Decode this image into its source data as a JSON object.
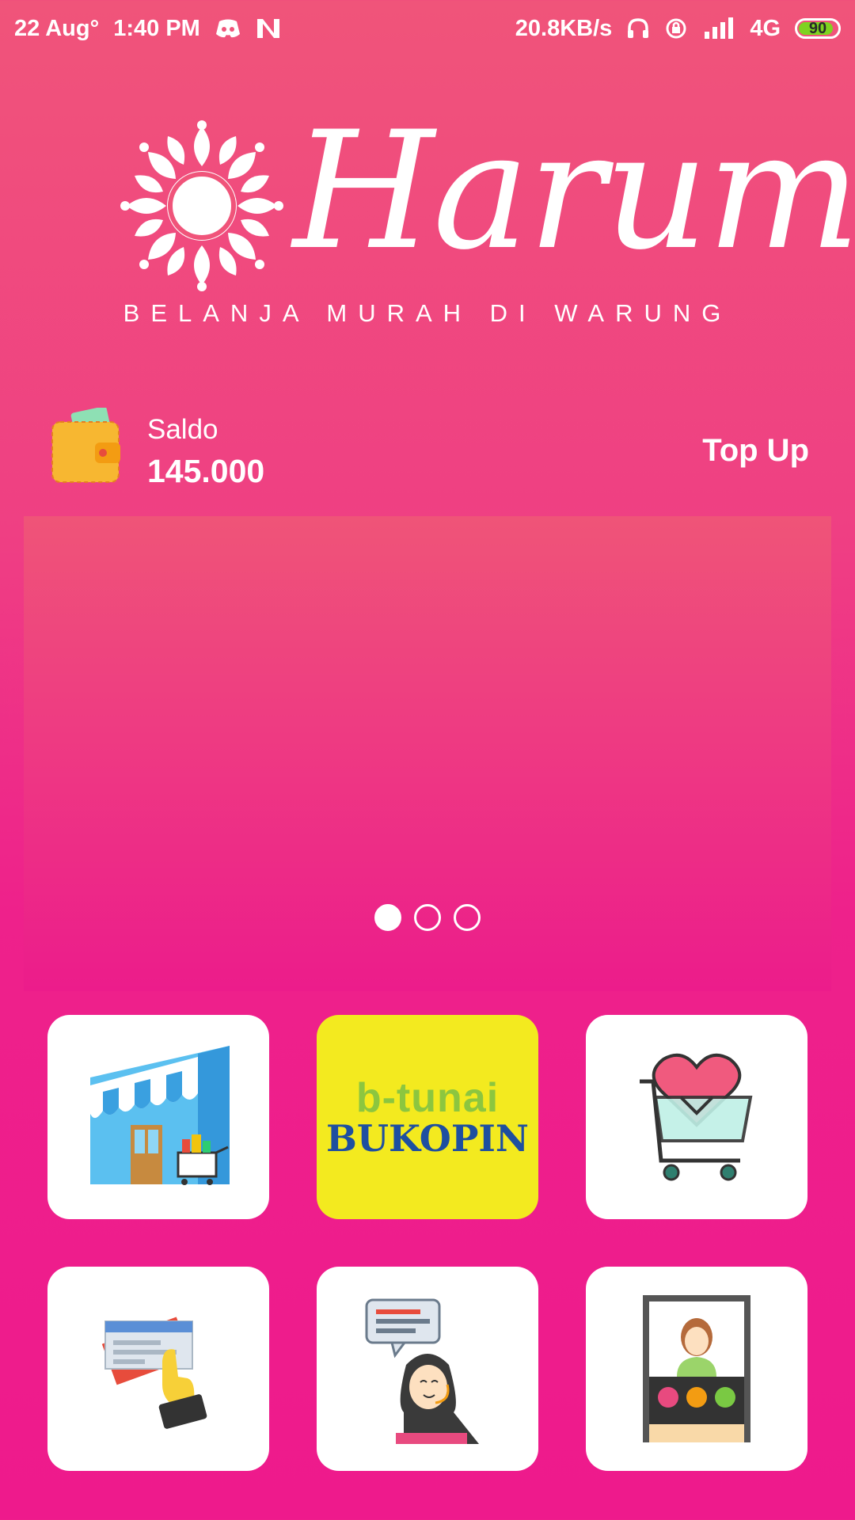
{
  "status_bar": {
    "date": "22 Aug°",
    "time": "1:40 PM",
    "network_speed": "20.8KB/s",
    "network_type": "4G",
    "battery": "90",
    "icons": [
      "discord-icon",
      "n-notification-icon",
      "headphones-icon",
      "rotation-lock-icon",
      "signal-icon",
      "battery-icon"
    ]
  },
  "brand": {
    "name": "Harum",
    "tagline": "BELANJA MURAH DI WARUNG"
  },
  "wallet": {
    "label": "Saldo",
    "value": "145.000",
    "topup_label": "Top Up"
  },
  "banner": {
    "slides": 3,
    "active_slide": 1
  },
  "tiles": [
    {
      "name": "store",
      "icon": "storefront-icon"
    },
    {
      "name": "b-tunai",
      "icon": "btunai-bukopin-logo",
      "logo_line1": "b-tunai",
      "logo_line2": "BUKOPIN"
    },
    {
      "name": "wishlist",
      "icon": "heart-cart-icon"
    },
    {
      "name": "tickets",
      "icon": "air-ticket-icon"
    },
    {
      "name": "customer-service",
      "icon": "customer-service-icon"
    },
    {
      "name": "video",
      "icon": "video-call-icon"
    }
  ],
  "colors": {
    "background_top": "#f0547a",
    "background_bottom": "#ee1a8c",
    "tile_bg": "#ffffff",
    "btunai_bg": "#f3ea1f",
    "btunai_green": "#8cc63f",
    "btunai_blue": "#1e4fa0"
  }
}
